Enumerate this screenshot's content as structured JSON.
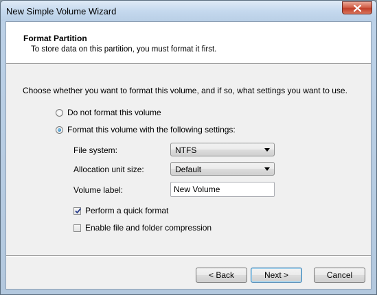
{
  "window": {
    "title": "New Simple Volume Wizard",
    "close_icon": "close-x-icon"
  },
  "header": {
    "title": "Format Partition",
    "subtitle": "To store data on this partition, you must format it first."
  },
  "prompt": "Choose whether you want to format this volume, and if so, what settings you want to use.",
  "options": {
    "no_format_label": "Do not format this volume",
    "format_label": "Format this volume with the following settings:",
    "selected": "format"
  },
  "fields": {
    "file_system_label": "File system:",
    "file_system_value": "NTFS",
    "allocation_label": "Allocation unit size:",
    "allocation_value": "Default",
    "volume_label_label": "Volume label:",
    "volume_label_value": "New Volume"
  },
  "checkboxes": {
    "quick_format_label": "Perform a quick format",
    "quick_format_checked": true,
    "compression_label": "Enable file and folder compression",
    "compression_checked": false
  },
  "buttons": {
    "back": "< Back",
    "next": "Next >",
    "cancel": "Cancel"
  },
  "colors": {
    "close_button": "#c2402a",
    "default_button_border": "#3c7fb1",
    "radio_selected": "#1d6fa8"
  }
}
